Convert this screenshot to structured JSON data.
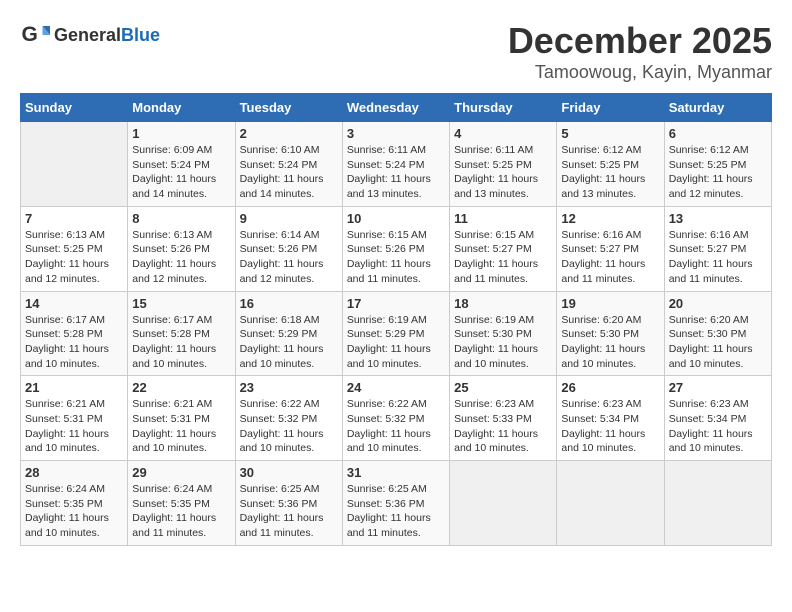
{
  "logo": {
    "general": "General",
    "blue": "Blue"
  },
  "title": {
    "month": "December 2025",
    "location": "Tamoowoug, Kayin, Myanmar"
  },
  "headers": [
    "Sunday",
    "Monday",
    "Tuesday",
    "Wednesday",
    "Thursday",
    "Friday",
    "Saturday"
  ],
  "weeks": [
    [
      {
        "day": null
      },
      {
        "day": "1",
        "sunrise": "6:09 AM",
        "sunset": "5:24 PM",
        "daylight": "11 hours and 14 minutes."
      },
      {
        "day": "2",
        "sunrise": "6:10 AM",
        "sunset": "5:24 PM",
        "daylight": "11 hours and 14 minutes."
      },
      {
        "day": "3",
        "sunrise": "6:11 AM",
        "sunset": "5:24 PM",
        "daylight": "11 hours and 13 minutes."
      },
      {
        "day": "4",
        "sunrise": "6:11 AM",
        "sunset": "5:25 PM",
        "daylight": "11 hours and 13 minutes."
      },
      {
        "day": "5",
        "sunrise": "6:12 AM",
        "sunset": "5:25 PM",
        "daylight": "11 hours and 13 minutes."
      },
      {
        "day": "6",
        "sunrise": "6:12 AM",
        "sunset": "5:25 PM",
        "daylight": "11 hours and 12 minutes."
      }
    ],
    [
      {
        "day": "7",
        "sunrise": "6:13 AM",
        "sunset": "5:25 PM",
        "daylight": "11 hours and 12 minutes."
      },
      {
        "day": "8",
        "sunrise": "6:13 AM",
        "sunset": "5:26 PM",
        "daylight": "11 hours and 12 minutes."
      },
      {
        "day": "9",
        "sunrise": "6:14 AM",
        "sunset": "5:26 PM",
        "daylight": "11 hours and 12 minutes."
      },
      {
        "day": "10",
        "sunrise": "6:15 AM",
        "sunset": "5:26 PM",
        "daylight": "11 hours and 11 minutes."
      },
      {
        "day": "11",
        "sunrise": "6:15 AM",
        "sunset": "5:27 PM",
        "daylight": "11 hours and 11 minutes."
      },
      {
        "day": "12",
        "sunrise": "6:16 AM",
        "sunset": "5:27 PM",
        "daylight": "11 hours and 11 minutes."
      },
      {
        "day": "13",
        "sunrise": "6:16 AM",
        "sunset": "5:27 PM",
        "daylight": "11 hours and 11 minutes."
      }
    ],
    [
      {
        "day": "14",
        "sunrise": "6:17 AM",
        "sunset": "5:28 PM",
        "daylight": "11 hours and 10 minutes."
      },
      {
        "day": "15",
        "sunrise": "6:17 AM",
        "sunset": "5:28 PM",
        "daylight": "11 hours and 10 minutes."
      },
      {
        "day": "16",
        "sunrise": "6:18 AM",
        "sunset": "5:29 PM",
        "daylight": "11 hours and 10 minutes."
      },
      {
        "day": "17",
        "sunrise": "6:19 AM",
        "sunset": "5:29 PM",
        "daylight": "11 hours and 10 minutes."
      },
      {
        "day": "18",
        "sunrise": "6:19 AM",
        "sunset": "5:30 PM",
        "daylight": "11 hours and 10 minutes."
      },
      {
        "day": "19",
        "sunrise": "6:20 AM",
        "sunset": "5:30 PM",
        "daylight": "11 hours and 10 minutes."
      },
      {
        "day": "20",
        "sunrise": "6:20 AM",
        "sunset": "5:30 PM",
        "daylight": "11 hours and 10 minutes."
      }
    ],
    [
      {
        "day": "21",
        "sunrise": "6:21 AM",
        "sunset": "5:31 PM",
        "daylight": "11 hours and 10 minutes."
      },
      {
        "day": "22",
        "sunrise": "6:21 AM",
        "sunset": "5:31 PM",
        "daylight": "11 hours and 10 minutes."
      },
      {
        "day": "23",
        "sunrise": "6:22 AM",
        "sunset": "5:32 PM",
        "daylight": "11 hours and 10 minutes."
      },
      {
        "day": "24",
        "sunrise": "6:22 AM",
        "sunset": "5:32 PM",
        "daylight": "11 hours and 10 minutes."
      },
      {
        "day": "25",
        "sunrise": "6:23 AM",
        "sunset": "5:33 PM",
        "daylight": "11 hours and 10 minutes."
      },
      {
        "day": "26",
        "sunrise": "6:23 AM",
        "sunset": "5:34 PM",
        "daylight": "11 hours and 10 minutes."
      },
      {
        "day": "27",
        "sunrise": "6:23 AM",
        "sunset": "5:34 PM",
        "daylight": "11 hours and 10 minutes."
      }
    ],
    [
      {
        "day": "28",
        "sunrise": "6:24 AM",
        "sunset": "5:35 PM",
        "daylight": "11 hours and 10 minutes."
      },
      {
        "day": "29",
        "sunrise": "6:24 AM",
        "sunset": "5:35 PM",
        "daylight": "11 hours and 11 minutes."
      },
      {
        "day": "30",
        "sunrise": "6:25 AM",
        "sunset": "5:36 PM",
        "daylight": "11 hours and 11 minutes."
      },
      {
        "day": "31",
        "sunrise": "6:25 AM",
        "sunset": "5:36 PM",
        "daylight": "11 hours and 11 minutes."
      },
      {
        "day": null
      },
      {
        "day": null
      },
      {
        "day": null
      }
    ]
  ]
}
